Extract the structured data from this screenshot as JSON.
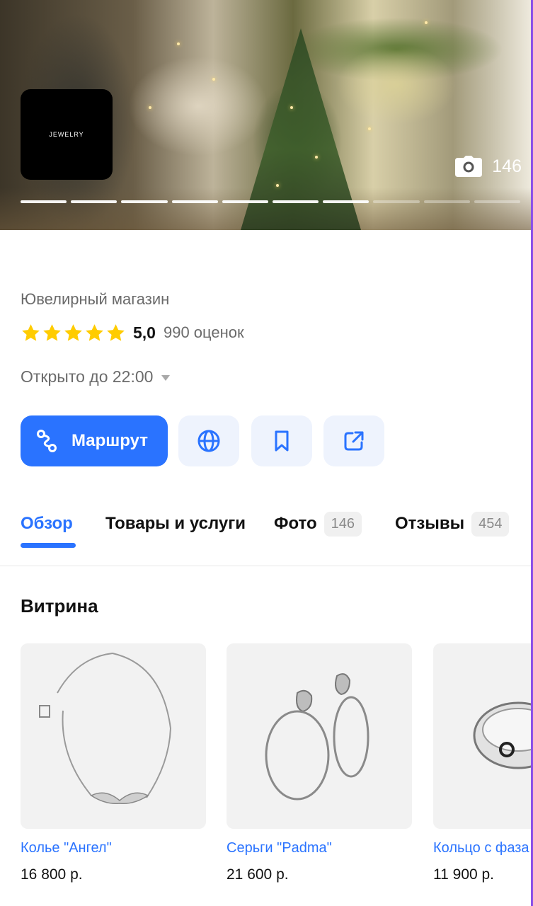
{
  "hero": {
    "logo_text": "JEWELRY",
    "photo_count": "146",
    "gallery_progress": {
      "total": 10,
      "current": 7
    }
  },
  "info": {
    "category": "Ювелирный магазин",
    "rating_value": "5,0",
    "rating_stars": 5,
    "rating_count": "990 оценок",
    "hours": "Открыто до 22:00"
  },
  "actions": {
    "route_label": "Маршрут",
    "icons": [
      "route-icon",
      "globe-icon",
      "bookmark-icon",
      "share-icon"
    ]
  },
  "tabs": [
    {
      "label": "Обзор",
      "active": true
    },
    {
      "label": "Товары и услуги",
      "active": false
    },
    {
      "label": "Фото",
      "badge": "146",
      "active": false
    },
    {
      "label": "Отзывы",
      "badge": "454",
      "active": false
    }
  ],
  "showcase": {
    "title": "Витрина",
    "items": [
      {
        "name": "Колье \"Ангел\"",
        "price": "16 800 р."
      },
      {
        "name": "Серьги \"Padma\"",
        "price": "21 600 р."
      },
      {
        "name": "Кольцо с фаза",
        "price": "11 900 р."
      }
    ]
  },
  "colors": {
    "accent": "#2a73ff",
    "accent_soft": "#eef3fd",
    "star": "#ffcc00",
    "muted_text": "#6b6b6b"
  }
}
